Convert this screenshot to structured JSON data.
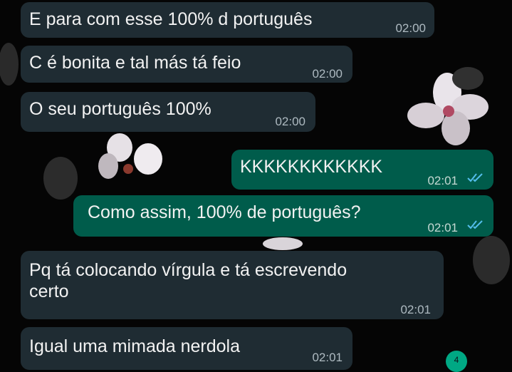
{
  "messages": [
    {
      "direction": "in",
      "text": "E para com esse 100% d português",
      "time": "02:00"
    },
    {
      "direction": "in",
      "text": "C é bonita e tal más tá feio",
      "time": "02:00"
    },
    {
      "direction": "in",
      "text": "O seu português 100%",
      "time": "02:00"
    },
    {
      "direction": "out",
      "text": "KKKKKKKKKKKK",
      "time": "02:01",
      "status": "read-double-check-icon"
    },
    {
      "direction": "out",
      "text": "Como assim, 100% de português?",
      "time": "02:01",
      "status": "read-double-check-icon"
    },
    {
      "direction": "in",
      "text_line1": "Pq tá colocando vírgula e tá escrevendo",
      "text_line2": "certo",
      "time": "02:01"
    },
    {
      "direction": "in",
      "text": "Igual uma mimada nerdola",
      "time": "02:01"
    }
  ],
  "scroll_badge": {
    "count": "4",
    "color": "#00a884"
  },
  "colors": {
    "background": "#050505",
    "incoming_bubble": "#1f2c33",
    "outgoing_bubble": "#005c4b",
    "read_ticks": "#53bdeb"
  }
}
